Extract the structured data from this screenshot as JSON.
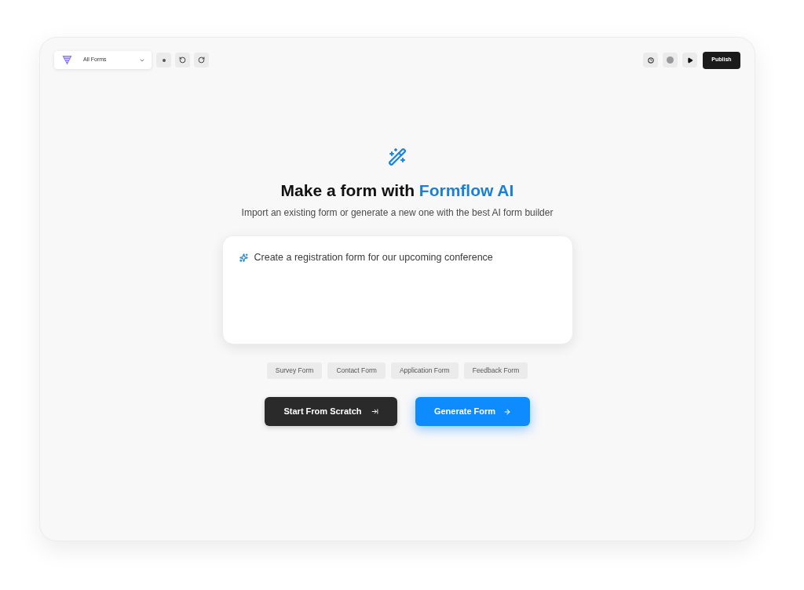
{
  "toolbar": {
    "form_select": {
      "value": "All Forms"
    },
    "publish_button": "Publish"
  },
  "hero": {
    "title": "Make a form with",
    "title_highlight": "Formflow AI",
    "subtitle": "Import an existing form or generate a new one with the best AI form builder"
  },
  "prompt": {
    "value": "Create a registration form for our upcoming conference"
  },
  "templates": [
    "Survey Form",
    "Contact Form",
    "Application Form",
    "Feedback Form"
  ],
  "actions": [
    {
      "label": "Start From Scratch",
      "kind": "secondary"
    },
    {
      "label": "Generate Form",
      "kind": "primary"
    }
  ]
}
